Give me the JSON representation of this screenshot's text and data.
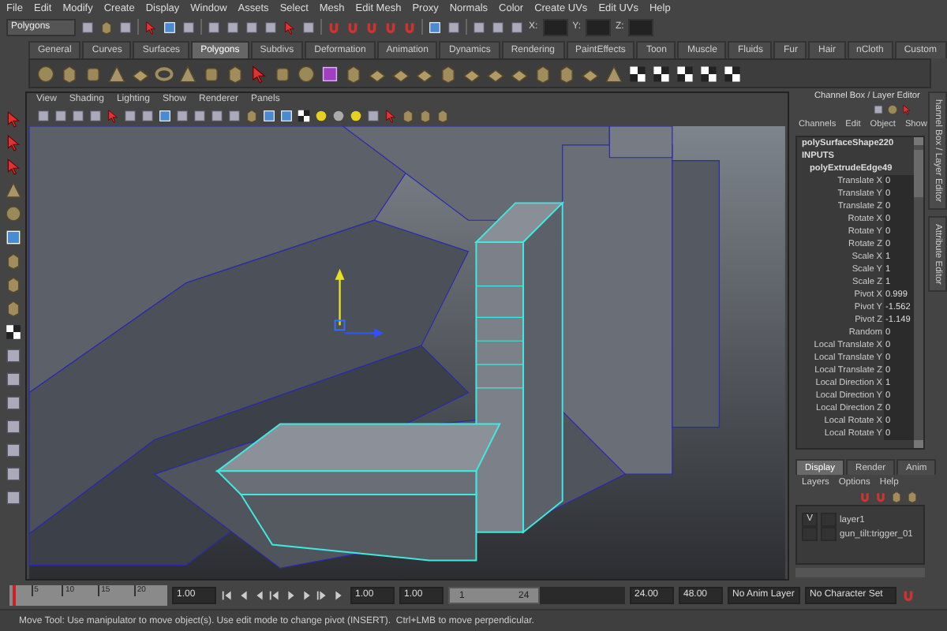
{
  "menu_bar": [
    "File",
    "Edit",
    "Modify",
    "Create",
    "Display",
    "Window",
    "Assets",
    "Select",
    "Mesh",
    "Edit Mesh",
    "Proxy",
    "Normals",
    "Color",
    "Create UVs",
    "Edit UVs",
    "Help"
  ],
  "status_line": {
    "mode": "Polygons",
    "x_label": "X:",
    "y_label": "Y:",
    "z_label": "Z:"
  },
  "shelf": {
    "tabs": [
      {
        "label": "General",
        "selected": false
      },
      {
        "label": "Curves",
        "selected": false
      },
      {
        "label": "Surfaces",
        "selected": false
      },
      {
        "label": "Polygons",
        "selected": true
      },
      {
        "label": "Subdivs",
        "selected": false
      },
      {
        "label": "Deformation",
        "selected": false
      },
      {
        "label": "Animation",
        "selected": false
      },
      {
        "label": "Dynamics",
        "selected": false
      },
      {
        "label": "Rendering",
        "selected": false
      },
      {
        "label": "PaintEffects",
        "selected": false
      },
      {
        "label": "Toon",
        "selected": false
      },
      {
        "label": "Muscle",
        "selected": false
      },
      {
        "label": "Fluids",
        "selected": false
      },
      {
        "label": "Fur",
        "selected": false
      },
      {
        "label": "Hair",
        "selected": false
      },
      {
        "label": "nCloth",
        "selected": false
      },
      {
        "label": "Custom",
        "selected": false
      }
    ]
  },
  "viewport": {
    "menus": [
      "View",
      "Shading",
      "Lighting",
      "Show",
      "Renderer",
      "Panels"
    ]
  },
  "channel_box": {
    "title": "Channel Box / Layer Editor",
    "menus": [
      "Channels",
      "Edit",
      "Object",
      "Show"
    ],
    "object": "polySurfaceShape220",
    "inputs_label": "INPUTS",
    "node": "polyExtrudeEdge49",
    "channels": [
      {
        "name": "Translate X",
        "value": "0"
      },
      {
        "name": "Translate Y",
        "value": "0"
      },
      {
        "name": "Translate Z",
        "value": "0"
      },
      {
        "name": "Rotate X",
        "value": "0"
      },
      {
        "name": "Rotate Y",
        "value": "0"
      },
      {
        "name": "Rotate Z",
        "value": "0"
      },
      {
        "name": "Scale X",
        "value": "1"
      },
      {
        "name": "Scale Y",
        "value": "1"
      },
      {
        "name": "Scale Z",
        "value": "1"
      },
      {
        "name": "Pivot X",
        "value": "0.999"
      },
      {
        "name": "Pivot Y",
        "value": "-1.562"
      },
      {
        "name": "Pivot Z",
        "value": "-1.149"
      },
      {
        "name": "Random",
        "value": "0"
      },
      {
        "name": "Local Translate X",
        "value": "0"
      },
      {
        "name": "Local Translate Y",
        "value": "0"
      },
      {
        "name": "Local Translate Z",
        "value": "0"
      },
      {
        "name": "Local Direction X",
        "value": "1"
      },
      {
        "name": "Local Direction Y",
        "value": "0"
      },
      {
        "name": "Local Direction Z",
        "value": "0"
      },
      {
        "name": "Local Rotate X",
        "value": "0"
      },
      {
        "name": "Local Rotate Y",
        "value": "0"
      }
    ]
  },
  "side_tabs": [
    "hannel Box / Layer Editor",
    "Attribute Editor"
  ],
  "layer_editor": {
    "tabs": [
      {
        "label": "Display",
        "selected": true
      },
      {
        "label": "Render",
        "selected": false
      },
      {
        "label": "Anim",
        "selected": false
      }
    ],
    "menus": [
      "Layers",
      "Options",
      "Help"
    ],
    "layers": [
      {
        "visibility": "V",
        "name": "layer1"
      },
      {
        "name": "gun_tilt:trigger_01"
      }
    ]
  },
  "time_slider": {
    "ticks": [
      "5",
      "10",
      "15",
      "20"
    ],
    "current_time": "1.00",
    "level": 0.02
  },
  "range_slider": {
    "start": "1.00",
    "playback_start": "1.00",
    "range_start": "1",
    "range_end": "24",
    "level": 0.52,
    "playback_end": "24.00",
    "end": "48.00",
    "anim_layer": "No Anim Layer",
    "character_set": "No Character Set"
  },
  "help_line": "Move Tool: Use manipulator to move object(s). Use edit mode to change pivot (INSERT).  Ctrl+LMB to move perpendicular."
}
